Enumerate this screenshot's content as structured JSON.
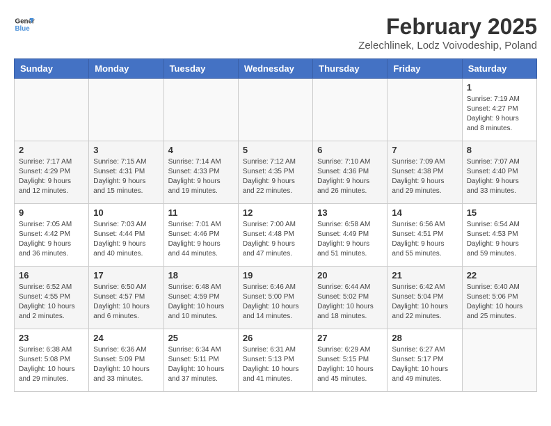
{
  "header": {
    "logo_line1": "General",
    "logo_line2": "Blue",
    "month_year": "February 2025",
    "location": "Zelechlinek, Lodz Voivodeship, Poland"
  },
  "days_of_week": [
    "Sunday",
    "Monday",
    "Tuesday",
    "Wednesday",
    "Thursday",
    "Friday",
    "Saturday"
  ],
  "weeks": [
    [
      {
        "day": "",
        "info": ""
      },
      {
        "day": "",
        "info": ""
      },
      {
        "day": "",
        "info": ""
      },
      {
        "day": "",
        "info": ""
      },
      {
        "day": "",
        "info": ""
      },
      {
        "day": "",
        "info": ""
      },
      {
        "day": "1",
        "info": "Sunrise: 7:19 AM\nSunset: 4:27 PM\nDaylight: 9 hours and 8 minutes."
      }
    ],
    [
      {
        "day": "2",
        "info": "Sunrise: 7:17 AM\nSunset: 4:29 PM\nDaylight: 9 hours and 12 minutes."
      },
      {
        "day": "3",
        "info": "Sunrise: 7:15 AM\nSunset: 4:31 PM\nDaylight: 9 hours and 15 minutes."
      },
      {
        "day": "4",
        "info": "Sunrise: 7:14 AM\nSunset: 4:33 PM\nDaylight: 9 hours and 19 minutes."
      },
      {
        "day": "5",
        "info": "Sunrise: 7:12 AM\nSunset: 4:35 PM\nDaylight: 9 hours and 22 minutes."
      },
      {
        "day": "6",
        "info": "Sunrise: 7:10 AM\nSunset: 4:36 PM\nDaylight: 9 hours and 26 minutes."
      },
      {
        "day": "7",
        "info": "Sunrise: 7:09 AM\nSunset: 4:38 PM\nDaylight: 9 hours and 29 minutes."
      },
      {
        "day": "8",
        "info": "Sunrise: 7:07 AM\nSunset: 4:40 PM\nDaylight: 9 hours and 33 minutes."
      }
    ],
    [
      {
        "day": "9",
        "info": "Sunrise: 7:05 AM\nSunset: 4:42 PM\nDaylight: 9 hours and 36 minutes."
      },
      {
        "day": "10",
        "info": "Sunrise: 7:03 AM\nSunset: 4:44 PM\nDaylight: 9 hours and 40 minutes."
      },
      {
        "day": "11",
        "info": "Sunrise: 7:01 AM\nSunset: 4:46 PM\nDaylight: 9 hours and 44 minutes."
      },
      {
        "day": "12",
        "info": "Sunrise: 7:00 AM\nSunset: 4:48 PM\nDaylight: 9 hours and 47 minutes."
      },
      {
        "day": "13",
        "info": "Sunrise: 6:58 AM\nSunset: 4:49 PM\nDaylight: 9 hours and 51 minutes."
      },
      {
        "day": "14",
        "info": "Sunrise: 6:56 AM\nSunset: 4:51 PM\nDaylight: 9 hours and 55 minutes."
      },
      {
        "day": "15",
        "info": "Sunrise: 6:54 AM\nSunset: 4:53 PM\nDaylight: 9 hours and 59 minutes."
      }
    ],
    [
      {
        "day": "16",
        "info": "Sunrise: 6:52 AM\nSunset: 4:55 PM\nDaylight: 10 hours and 2 minutes."
      },
      {
        "day": "17",
        "info": "Sunrise: 6:50 AM\nSunset: 4:57 PM\nDaylight: 10 hours and 6 minutes."
      },
      {
        "day": "18",
        "info": "Sunrise: 6:48 AM\nSunset: 4:59 PM\nDaylight: 10 hours and 10 minutes."
      },
      {
        "day": "19",
        "info": "Sunrise: 6:46 AM\nSunset: 5:00 PM\nDaylight: 10 hours and 14 minutes."
      },
      {
        "day": "20",
        "info": "Sunrise: 6:44 AM\nSunset: 5:02 PM\nDaylight: 10 hours and 18 minutes."
      },
      {
        "day": "21",
        "info": "Sunrise: 6:42 AM\nSunset: 5:04 PM\nDaylight: 10 hours and 22 minutes."
      },
      {
        "day": "22",
        "info": "Sunrise: 6:40 AM\nSunset: 5:06 PM\nDaylight: 10 hours and 25 minutes."
      }
    ],
    [
      {
        "day": "23",
        "info": "Sunrise: 6:38 AM\nSunset: 5:08 PM\nDaylight: 10 hours and 29 minutes."
      },
      {
        "day": "24",
        "info": "Sunrise: 6:36 AM\nSunset: 5:09 PM\nDaylight: 10 hours and 33 minutes."
      },
      {
        "day": "25",
        "info": "Sunrise: 6:34 AM\nSunset: 5:11 PM\nDaylight: 10 hours and 37 minutes."
      },
      {
        "day": "26",
        "info": "Sunrise: 6:31 AM\nSunset: 5:13 PM\nDaylight: 10 hours and 41 minutes."
      },
      {
        "day": "27",
        "info": "Sunrise: 6:29 AM\nSunset: 5:15 PM\nDaylight: 10 hours and 45 minutes."
      },
      {
        "day": "28",
        "info": "Sunrise: 6:27 AM\nSunset: 5:17 PM\nDaylight: 10 hours and 49 minutes."
      },
      {
        "day": "",
        "info": ""
      }
    ]
  ]
}
